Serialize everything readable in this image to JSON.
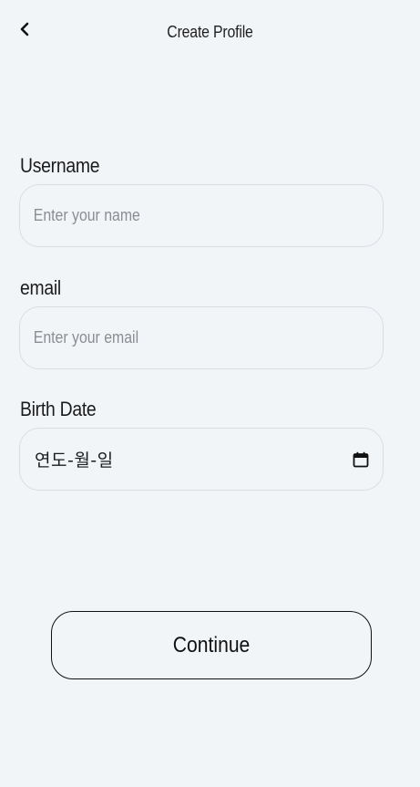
{
  "header": {
    "title": "Create Profile",
    "back_icon": "chevron-left-icon"
  },
  "form": {
    "username": {
      "label": "Username",
      "placeholder": "Enter your name",
      "value": ""
    },
    "email": {
      "label": "email",
      "placeholder": "Enter your email",
      "value": ""
    },
    "birth_date": {
      "label": "Birth Date",
      "value": "연도-월-일",
      "icon": "calendar-icon"
    }
  },
  "actions": {
    "continue_label": "Continue"
  },
  "colors": {
    "background": "#f2f5f8",
    "field_border": "#d9dde2",
    "button_border": "#111111",
    "placeholder": "#8a8d91"
  }
}
